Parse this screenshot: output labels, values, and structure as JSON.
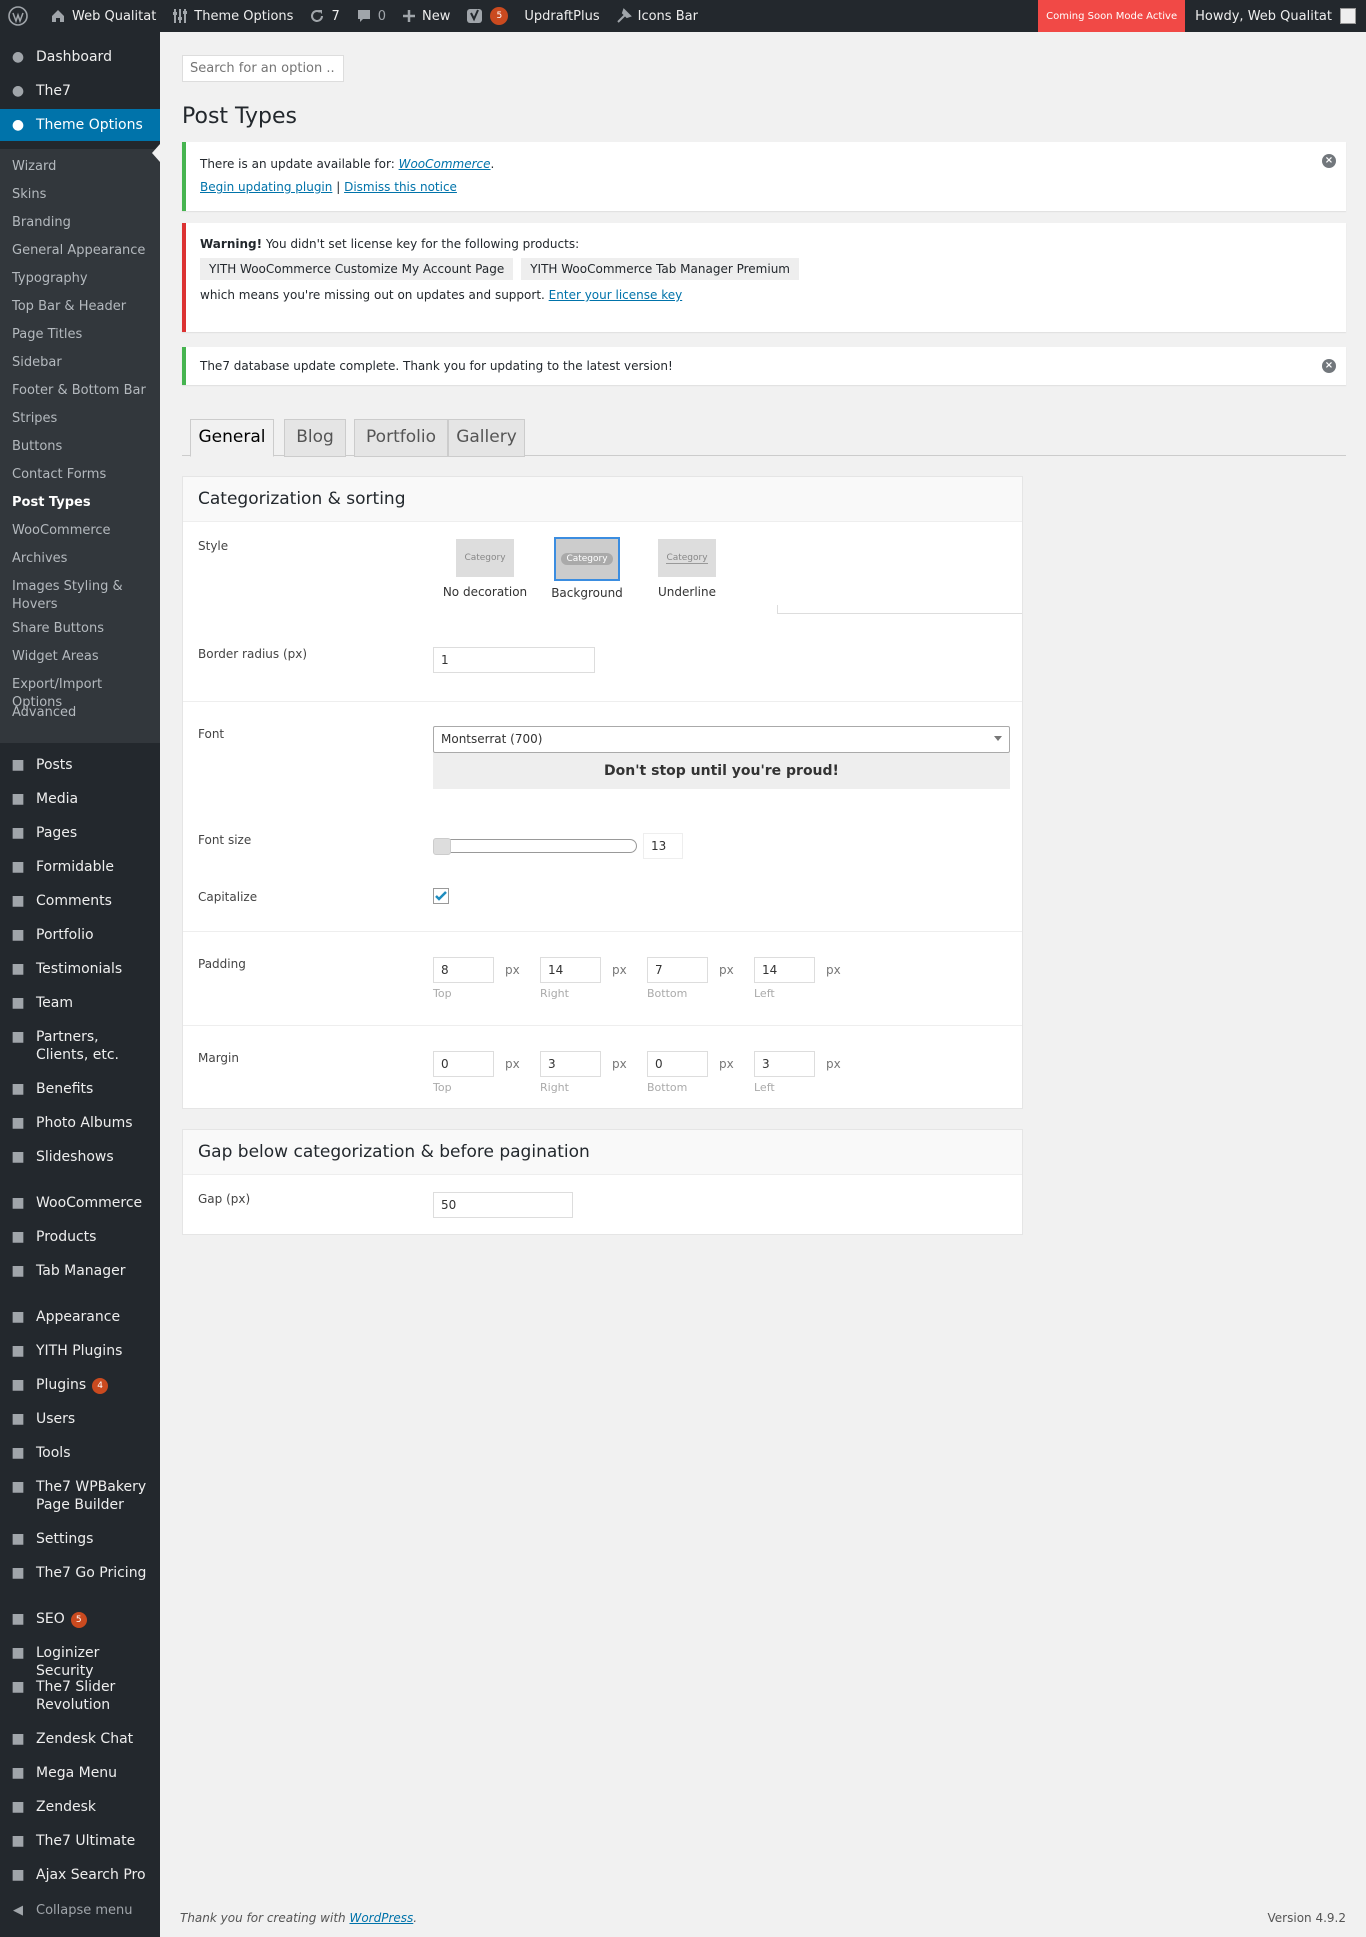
{
  "adminbar": {
    "site_name": "Web Qualitat",
    "theme_options": "Theme Options",
    "updates_count": "7",
    "comments_count": "0",
    "new_label": "New",
    "yoast_count": "5",
    "updraft": "UpdraftPlus",
    "icons_bar": "Icons Bar",
    "coming_soon": "Coming Soon Mode Active",
    "howdy": "Howdy, Web Qualitat"
  },
  "sidebar": {
    "top": [
      {
        "label": "Dashboard",
        "icon": "dashboard-icon"
      },
      {
        "label": "The7",
        "icon": "the7-icon"
      },
      {
        "label": "Theme Options",
        "icon": "gear-icon"
      }
    ],
    "submenu": [
      "Wizard",
      "Skins",
      "Branding",
      "General Appearance",
      "Typography",
      "Top Bar & Header",
      "Page Titles",
      "Sidebar",
      "Footer & Bottom Bar",
      "Stripes",
      "Buttons",
      "Contact Forms",
      "Post Types",
      "WooCommerce",
      "Archives",
      "Images Styling & Hovers",
      "Share Buttons",
      "Widget Areas",
      "Export/Import Options",
      "Advanced"
    ],
    "main": [
      {
        "label": "Posts",
        "icon": "pin-icon"
      },
      {
        "label": "Media",
        "icon": "media-icon"
      },
      {
        "label": "Pages",
        "icon": "page-icon"
      },
      {
        "label": "Formidable",
        "icon": "formidable-icon"
      },
      {
        "label": "Comments",
        "icon": "comment-icon"
      },
      {
        "label": "Portfolio",
        "icon": "portfolio-icon"
      },
      {
        "label": "Testimonials",
        "icon": "testimonial-icon"
      },
      {
        "label": "Team",
        "icon": "team-icon"
      },
      {
        "label": "Partners, Clients, etc.",
        "icon": "star-icon"
      },
      {
        "label": "Benefits",
        "icon": "benefits-icon"
      },
      {
        "label": "Photo Albums",
        "icon": "album-icon"
      },
      {
        "label": "Slideshows",
        "icon": "slideshow-icon"
      },
      {
        "label": "WooCommerce",
        "icon": "woo-icon"
      },
      {
        "label": "Products",
        "icon": "product-icon"
      },
      {
        "label": "Tab Manager",
        "icon": "tab-icon"
      },
      {
        "label": "Appearance",
        "icon": "brush-icon"
      },
      {
        "label": "YITH Plugins",
        "icon": "yith-icon"
      },
      {
        "label": "Plugins",
        "icon": "plugin-icon",
        "badge": "4"
      },
      {
        "label": "Users",
        "icon": "user-icon"
      },
      {
        "label": "Tools",
        "icon": "wrench-icon"
      },
      {
        "label": "The7 WPBakery Page Builder",
        "icon": "cloud-icon"
      },
      {
        "label": "Settings",
        "icon": "settings-icon"
      },
      {
        "label": "The7 Go Pricing",
        "icon": "pricing-icon"
      },
      {
        "label": "SEO",
        "icon": "yoast-icon",
        "badge": "5"
      },
      {
        "label": "Loginizer Security",
        "icon": "gear-icon"
      },
      {
        "label": "The7 Slider Revolution",
        "icon": "refresh-icon"
      },
      {
        "label": "Zendesk Chat",
        "icon": "chat-icon"
      },
      {
        "label": "Mega Menu",
        "icon": "menu-icon"
      },
      {
        "label": "Zendesk",
        "icon": "zendesk-icon"
      },
      {
        "label": "The7 Ultimate",
        "icon": "shield-icon"
      },
      {
        "label": "Ajax Search Pro",
        "icon": "search-icon"
      }
    ],
    "collapse": "Collapse menu"
  },
  "search": {
    "placeholder": "Search for an option .."
  },
  "page_title": "Post Types",
  "notices": {
    "update": {
      "text": "There is an update available for:",
      "plugin": "WooCommerce",
      "begin": "Begin updating plugin",
      "sep": "|",
      "dismiss": "Dismiss this notice"
    },
    "license": {
      "warning": "Warning!",
      "text": "You didn't set license key for the following products:",
      "products": [
        "YITH WooCommerce Customize My Account Page",
        "YITH WooCommerce Tab Manager Premium"
      ],
      "missing": "which means you're missing out on updates and support.",
      "link": "Enter your license key"
    },
    "db": {
      "text": "The7 database update complete. Thank you for updating to the latest version!"
    }
  },
  "tabs": [
    "General",
    "Blog",
    "Portfolio",
    "Gallery"
  ],
  "cat_panel": {
    "title": "Categorization & sorting",
    "style_label": "Style",
    "thumb_text": "Category",
    "styles": [
      "No decoration",
      "Background",
      "Underline"
    ],
    "border_radius_label": "Border radius (px)",
    "border_radius": "1",
    "font_label": "Font",
    "font_value": "Montserrat (700)",
    "font_preview": "Don't stop until you're proud!",
    "font_size_label": "Font size",
    "font_size": "13",
    "font_size_level": 0.0,
    "capitalize_label": "Capitalize",
    "capitalize_checked": true,
    "padding_label": "Padding",
    "padding": {
      "top": "8",
      "right": "14",
      "bottom": "7",
      "left": "14"
    },
    "margin_label": "Margin",
    "margin": {
      "top": "0",
      "right": "3",
      "bottom": "0",
      "left": "3"
    },
    "unit": "px",
    "side_labels": {
      "top": "Top",
      "right": "Right",
      "bottom": "Bottom",
      "left": "Left"
    }
  },
  "gap_panel": {
    "title": "Gap below categorization & before pagination",
    "label": "Gap (px)",
    "value": "50"
  },
  "footer": {
    "thanks": "Thank you for creating with",
    "wp_link": "WordPress",
    "version": "Version 4.9.2"
  },
  "colors": {
    "accent": "#0073aa",
    "sidebar": "#23282d",
    "coming_soon": "#f14946",
    "badge": "#ca4a1f"
  }
}
